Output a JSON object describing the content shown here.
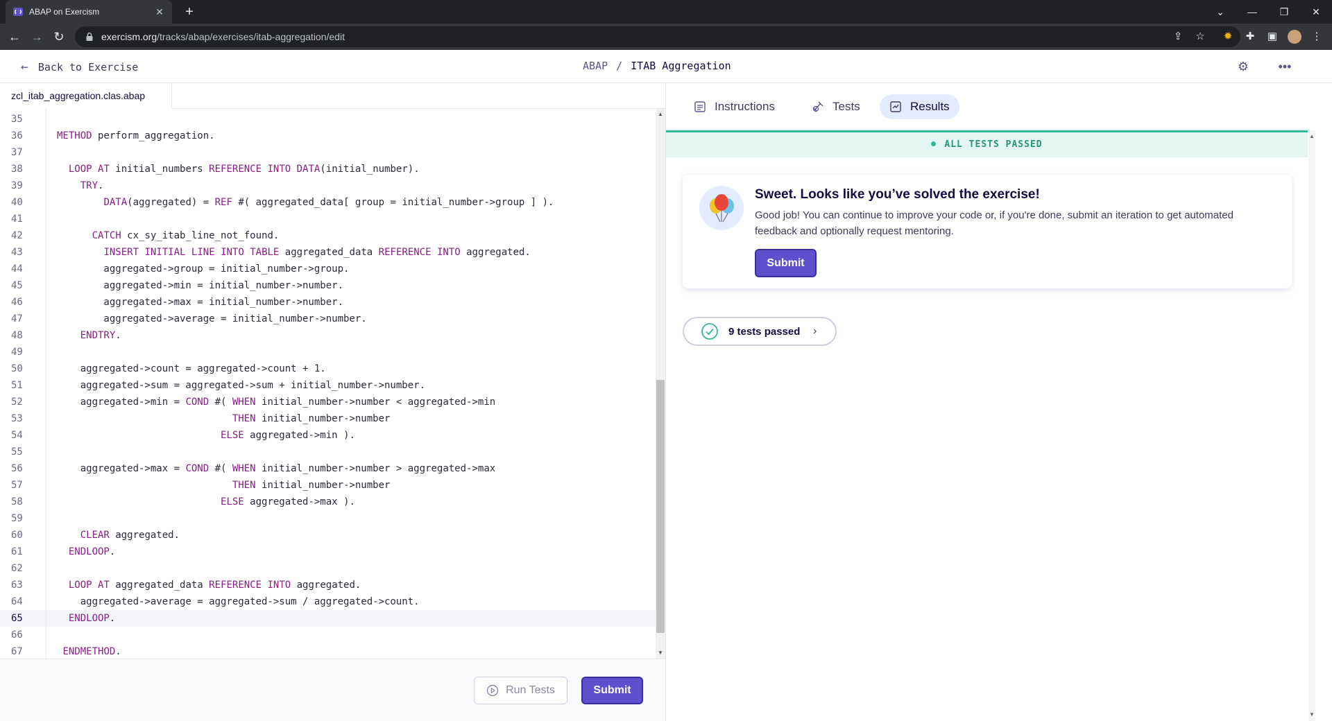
{
  "browser": {
    "tab_title": "ABAP on Exercism",
    "url_host": "exercism.org",
    "url_path": "/tracks/abap/exercises/itab-aggregation/edit"
  },
  "header": {
    "back_label": "Back to Exercise",
    "track": "ABAP",
    "separator": "/",
    "exercise": "ITAB Aggregation"
  },
  "editor": {
    "filename": "zcl_itab_aggregation.clas.abap",
    "active_line": 65,
    "lines": [
      {
        "n": "35",
        "code": ""
      },
      {
        "n": "36",
        "code": "METHOD perform_aggregation."
      },
      {
        "n": "37",
        "code": ""
      },
      {
        "n": "38",
        "code": "  LOOP AT initial_numbers REFERENCE INTO DATA(initial_number)."
      },
      {
        "n": "39",
        "code": "    TRY."
      },
      {
        "n": "40",
        "code": "        DATA(aggregated) = REF #( aggregated_data[ group = initial_number->group ] )."
      },
      {
        "n": "41",
        "code": ""
      },
      {
        "n": "42",
        "code": "      CATCH cx_sy_itab_line_not_found."
      },
      {
        "n": "43",
        "code": "        INSERT INITIAL LINE INTO TABLE aggregated_data REFERENCE INTO aggregated."
      },
      {
        "n": "44",
        "code": "        aggregated->group = initial_number->group."
      },
      {
        "n": "45",
        "code": "        aggregated->min = initial_number->number."
      },
      {
        "n": "46",
        "code": "        aggregated->max = initial_number->number."
      },
      {
        "n": "47",
        "code": "        aggregated->average = initial_number->number."
      },
      {
        "n": "48",
        "code": "    ENDTRY."
      },
      {
        "n": "49",
        "code": ""
      },
      {
        "n": "50",
        "code": "    aggregated->count = aggregated->count + 1."
      },
      {
        "n": "51",
        "code": "    aggregated->sum = aggregated->sum + initial_number->number."
      },
      {
        "n": "52",
        "code": "    aggregated->min = COND #( WHEN initial_number->number < aggregated->min"
      },
      {
        "n": "53",
        "code": "                              THEN initial_number->number"
      },
      {
        "n": "54",
        "code": "                            ELSE aggregated->min )."
      },
      {
        "n": "55",
        "code": ""
      },
      {
        "n": "56",
        "code": "    aggregated->max = COND #( WHEN initial_number->number > aggregated->max"
      },
      {
        "n": "57",
        "code": "                              THEN initial_number->number"
      },
      {
        "n": "58",
        "code": "                            ELSE aggregated->max )."
      },
      {
        "n": "59",
        "code": ""
      },
      {
        "n": "60",
        "code": "    CLEAR aggregated."
      },
      {
        "n": "61",
        "code": "  ENDLOOP."
      },
      {
        "n": "62",
        "code": ""
      },
      {
        "n": "63",
        "code": "  LOOP AT aggregated_data REFERENCE INTO aggregated."
      },
      {
        "n": "64",
        "code": "    aggregated->average = aggregated->sum / aggregated->count."
      },
      {
        "n": "65",
        "code": "  ENDLOOP."
      },
      {
        "n": "66",
        "code": ""
      },
      {
        "n": "67",
        "code": " ENDMETHOD."
      }
    ],
    "run_tests_label": "Run Tests",
    "submit_label": "Submit"
  },
  "panel": {
    "tabs": [
      {
        "label": "Instructions",
        "icon": "instructions-icon"
      },
      {
        "label": "Tests",
        "icon": "tests-icon"
      },
      {
        "label": "Results",
        "icon": "results-icon"
      }
    ],
    "active_tab": "Results",
    "status_text": "ALL TESTS PASSED",
    "success_title": "Sweet. Looks like you’ve solved the exercise!",
    "success_body": "Good job! You can continue to improve your code or, if you're done, submit an iteration to get automated feedback and optionally request mentoring.",
    "success_submit_label": "Submit",
    "tests_passed_label": "9 tests passed"
  },
  "colors": {
    "accent": "#604fcd",
    "success": "#2fb89a",
    "keyword": "#8a1e8a"
  }
}
